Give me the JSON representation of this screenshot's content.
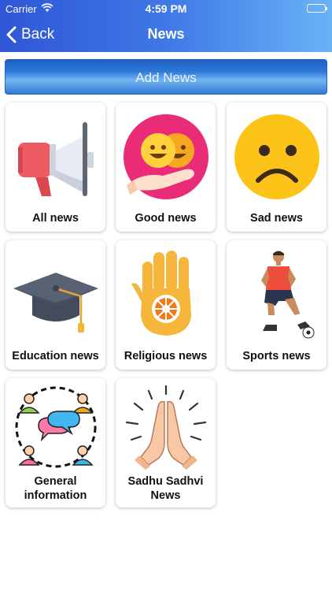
{
  "status_bar": {
    "carrier": "Carrier",
    "time": "4:59 PM"
  },
  "nav": {
    "back_label": "Back",
    "title": "News"
  },
  "add_news_label": "Add News",
  "categories": [
    {
      "label": "All news",
      "icon": "megaphone-icon"
    },
    {
      "label": "Good news",
      "icon": "happy-faces-icon"
    },
    {
      "label": "Sad news",
      "icon": "sad-face-icon"
    },
    {
      "label": "Education news",
      "icon": "graduation-cap-icon"
    },
    {
      "label": "Religious news",
      "icon": "ahimsa-hand-icon"
    },
    {
      "label": "Sports news",
      "icon": "football-player-icon"
    },
    {
      "label": "General information",
      "icon": "people-chat-icon"
    },
    {
      "label": "Sadhu Sadhvi News",
      "icon": "praying-hands-icon"
    }
  ],
  "colors": {
    "nav_start": "#2f56d6",
    "nav_end": "#69b3f6",
    "button": "#2e7ad9"
  }
}
